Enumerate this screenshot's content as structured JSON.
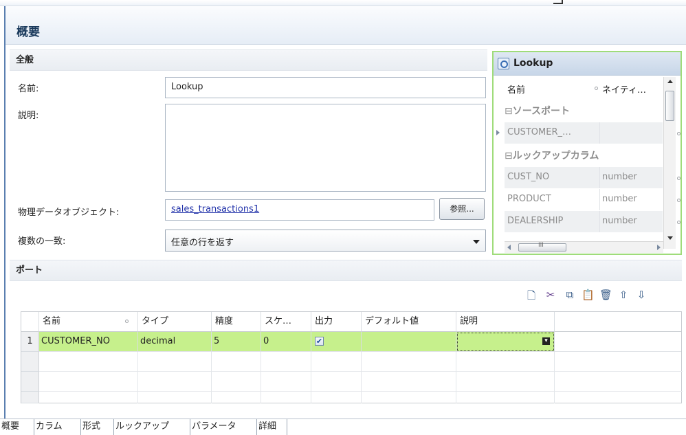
{
  "header": {
    "title": "概要"
  },
  "general": {
    "section_title": "全般",
    "name_label": "名前:",
    "name_value": "Lookup",
    "description_label": "説明:",
    "description_value": "",
    "physical_object_label": "物理データオブジェクト:",
    "physical_object_value": "sales_transactions1",
    "browse_button": "参照...",
    "multiple_match_label": "複数の一致:",
    "multiple_match_value": "任意の行を返す"
  },
  "lookup_panel": {
    "title": "Lookup",
    "col_name": "名前",
    "col_native": "ネイティ…",
    "group_source": "ソースポート",
    "source_rows": [
      {
        "name": "CUSTOMER_…",
        "type": ""
      }
    ],
    "group_lookup": "ルックアップカラム",
    "lookup_rows": [
      {
        "name": "CUST_NO",
        "type": "number"
      },
      {
        "name": "PRODUCT",
        "type": "number"
      },
      {
        "name": "DEALERSHIP",
        "type": "number"
      }
    ],
    "hscroll_grip": "III"
  },
  "ports": {
    "section_title": "ポート",
    "toolbar": [
      "new-icon",
      "cut-icon",
      "copy-icon",
      "paste-icon",
      "delete-icon",
      "move-up-icon",
      "move-down-icon"
    ],
    "columns": [
      "名前",
      "タイプ",
      "精度",
      "スケ…",
      "出力",
      "デフォルト値",
      "説明"
    ],
    "rows": [
      {
        "num": "1",
        "name": "CUSTOMER_NO",
        "type": "decimal",
        "precision": "5",
        "scale": "0",
        "output": true,
        "default": "",
        "description": ""
      }
    ],
    "highlight_color": "#c6f08c"
  },
  "tabs": [
    "概要",
    "カラム",
    "形式",
    "ルックアップ",
    "パラメータ",
    "詳細"
  ]
}
